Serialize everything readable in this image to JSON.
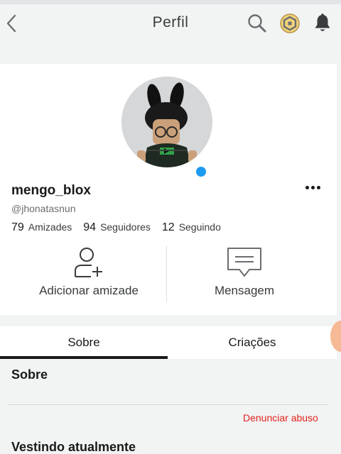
{
  "header": {
    "title": "Perfil",
    "icons": [
      "back-icon",
      "search-icon",
      "robux-icon",
      "notification-bell-icon"
    ]
  },
  "profile": {
    "display_name": "mengo_blox",
    "handle": "@jhonatasnun",
    "online_color": "#1d9bf0",
    "stats": {
      "friends_count": "79",
      "friends_label": "Amizades",
      "followers_count": "94",
      "followers_label": "Seguidores",
      "following_count": "12",
      "following_label": "Seguindo"
    },
    "actions": {
      "add_friend_label": "Adicionar amizade",
      "message_label": "Mensagem"
    }
  },
  "tabs": [
    {
      "label": "Sobre",
      "active": true
    },
    {
      "label": "Criações",
      "active": false
    }
  ],
  "about": {
    "title": "Sobre",
    "report_label": "Denunciar abuso",
    "report_color": "#e2231a"
  },
  "wearing": {
    "title": "Vestindo atualmente"
  }
}
